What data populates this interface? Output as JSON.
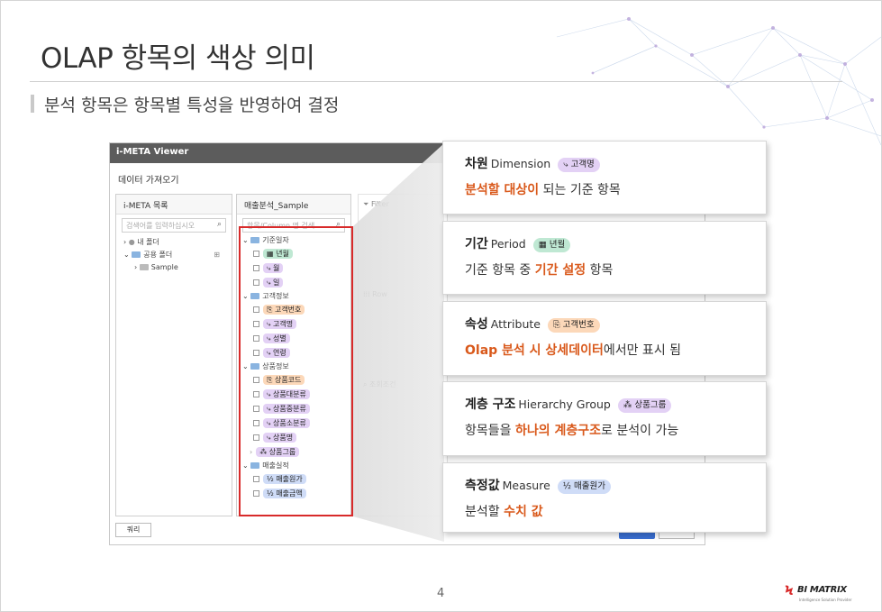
{
  "title": "OLAP 항목의 색상 의미",
  "subtitle": "분석 항목은 항목별 특성을 반영하여 결정",
  "page_number": "4",
  "logo": {
    "name": "BI MATRIX",
    "tagline": "Intelligence Solution Provider"
  },
  "viewer": {
    "window_title": "i-META Viewer",
    "toolbar_label": "데이터 가져오기",
    "left_panel": {
      "title": "i-META 목록",
      "search_placeholder": "검색어를 입력하십시오",
      "items": [
        "내 폴더",
        "공용 폴더",
        "Sample"
      ]
    },
    "mid_panel": {
      "title": "매출분석_Sample",
      "search_placeholder": "항목/Column 명 검색",
      "groups": [
        {
          "label": "기준일자",
          "items": [
            {
              "label": "년월",
              "kind": "date"
            },
            {
              "label": "월",
              "kind": "dim"
            },
            {
              "label": "일",
              "kind": "dim"
            }
          ]
        },
        {
          "label": "고객정보",
          "items": [
            {
              "label": "고객번호",
              "kind": "attr"
            },
            {
              "label": "고객명",
              "kind": "dim"
            },
            {
              "label": "성별",
              "kind": "dim"
            },
            {
              "label": "연령",
              "kind": "dim"
            }
          ]
        },
        {
          "label": "상품정보",
          "items": [
            {
              "label": "상품코드",
              "kind": "attr"
            },
            {
              "label": "상품대분류",
              "kind": "dim"
            },
            {
              "label": "상품중분류",
              "kind": "dim"
            },
            {
              "label": "상품소분류",
              "kind": "dim"
            },
            {
              "label": "상품명",
              "kind": "dim"
            },
            {
              "label": "상품그룹",
              "kind": "hier"
            }
          ]
        },
        {
          "label": "매출실적",
          "items": [
            {
              "label": "매출원가",
              "kind": "meas"
            },
            {
              "label": "매출금액",
              "kind": "meas"
            }
          ]
        }
      ]
    },
    "sections": {
      "filter": "Filter",
      "row": "Row",
      "condition": "조회조건"
    },
    "query_button": "쿼리"
  },
  "cards": [
    {
      "title": "차원",
      "en": "Dimension",
      "badge": "고객명",
      "badge_kind": "dim",
      "desc_hl": "분석할 대상이",
      "desc_rest": " 되는 기준 항목",
      "desc_pre": ""
    },
    {
      "title": "기간",
      "en": "Period",
      "badge": "년월",
      "badge_kind": "date",
      "desc_pre": "기준 항목 중 ",
      "desc_hl": "기간 설정",
      "desc_rest": " 항목"
    },
    {
      "title": "속성",
      "en": "Attribute",
      "badge": "고객번호",
      "badge_kind": "attr",
      "desc_pre": "",
      "desc_hl": "Olap 분석 시 상세데이터",
      "desc_rest": "에서만 표시 됨"
    },
    {
      "title": "계층 구조",
      "en": "Hierarchy Group",
      "badge": "상품그룹",
      "badge_kind": "hier",
      "desc_pre": "항목들을 ",
      "desc_hl": "하나의 계층구조",
      "desc_rest": "로 분석이 가능"
    },
    {
      "title": "측정값",
      "en": "Measure",
      "badge": "매출원가",
      "badge_kind": "meas",
      "desc_pre": "분석할 ",
      "desc_hl": "수치 값",
      "desc_rest": ""
    }
  ],
  "colors": {
    "highlight": "#d9591b",
    "dimension": "#e3d1f5",
    "period": "#bfe8d3",
    "attribute": "#fcd8b9",
    "measure": "#cfdcf7",
    "red_box": "#d82a2a"
  }
}
